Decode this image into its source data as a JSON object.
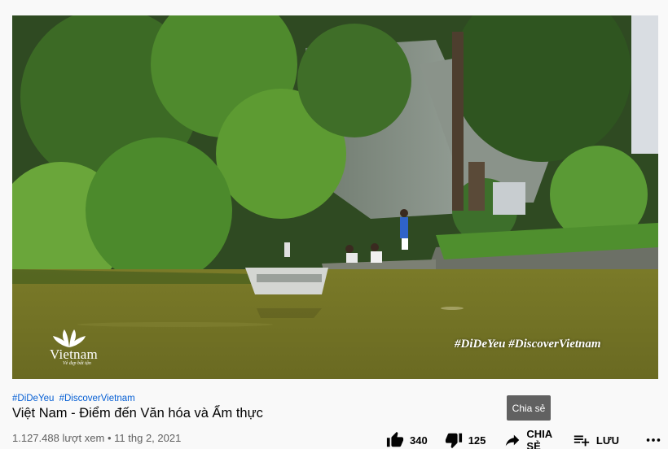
{
  "video": {
    "overlay_logo_word": "Vietnam",
    "overlay_logo_tagline": "Vẻ đẹp bất tận",
    "overlay_hashtags": "#DiDeYeu  #DiscoverVietnam"
  },
  "hashtags": [
    "#DiDeYeu",
    "#DiscoverVietnam"
  ],
  "title": "Việt Nam - Điểm đến Văn hóa và Ẩm thực",
  "meta": {
    "views": "1.127.488 lượt xem",
    "separator": "•",
    "date": "11 thg 2, 2021"
  },
  "tooltip": "Chia sẻ",
  "actions": {
    "like_count": "340",
    "dislike_count": "125",
    "share_label": "CHIA SẺ",
    "save_label": "LƯU"
  },
  "icons": {
    "like": "thumb-up-icon",
    "dislike": "thumb-down-icon",
    "share": "share-arrow-icon",
    "save": "playlist-add-icon",
    "more": "more-horizontal-icon"
  }
}
